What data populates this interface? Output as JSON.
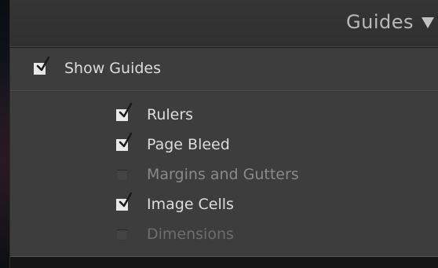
{
  "panel": {
    "title": "Guides",
    "show_guides": {
      "label": "Show Guides",
      "checked": true
    },
    "options": [
      {
        "label": "Rulers",
        "checked": true,
        "enabled": true
      },
      {
        "label": "Page Bleed",
        "checked": true,
        "enabled": true
      },
      {
        "label": "Margins and Gutters",
        "checked": false,
        "enabled": false
      },
      {
        "label": "Image Cells",
        "checked": true,
        "enabled": true
      },
      {
        "label": "Dimensions",
        "checked": false,
        "enabled": false
      }
    ]
  },
  "icons": {
    "disclosure": "triangle-down-icon",
    "check": "checkmark-icon"
  },
  "colors": {
    "panel_bg": "#3d3d3d",
    "header_bg": "#333333",
    "text": "#dcdcdc",
    "disabled_text": "#8a8a8a"
  }
}
